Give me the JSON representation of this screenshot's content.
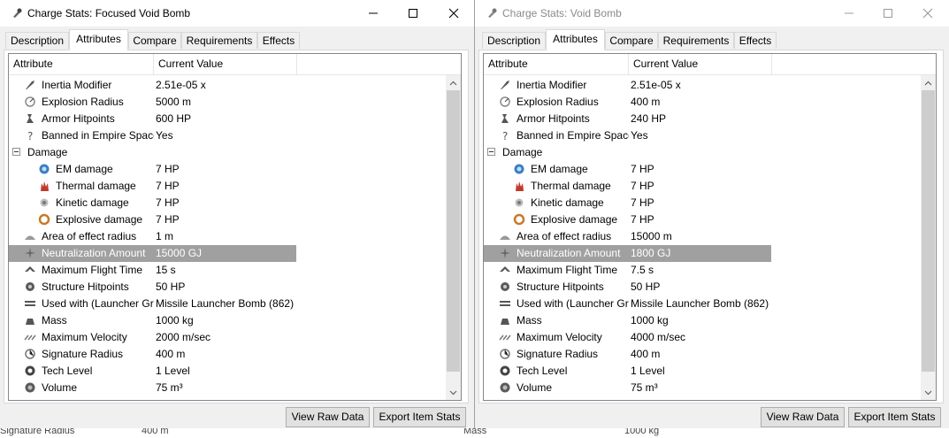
{
  "windows": [
    {
      "title": "Charge Stats: Focused Void Bomb",
      "tabs": [
        "Description",
        "Attributes",
        "Compare",
        "Requirements",
        "Effects"
      ],
      "active_tab": "Attributes",
      "columns": [
        "Attribute",
        "Current Value"
      ],
      "rows": [
        {
          "label": "Inertia Modifier",
          "value": "2.51e-05 x",
          "icon": "rocket-icon"
        },
        {
          "label": "Explosion Radius",
          "value": "5000 m",
          "icon": "explosion-radius-icon"
        },
        {
          "label": "Armor Hitpoints",
          "value": "600 HP",
          "icon": "armor-icon"
        },
        {
          "label": "Banned in Empire Space",
          "value": "Yes",
          "icon": "question-icon"
        },
        {
          "label": "Damage",
          "value": "",
          "icon": "",
          "group": true
        },
        {
          "label": "EM damage",
          "value": "7 HP",
          "icon": "em-damage-icon",
          "child": true
        },
        {
          "label": "Thermal damage",
          "value": "7 HP",
          "icon": "thermal-damage-icon",
          "child": true
        },
        {
          "label": "Kinetic damage",
          "value": "7 HP",
          "icon": "kinetic-damage-icon",
          "child": true
        },
        {
          "label": "Explosive damage",
          "value": "7 HP",
          "icon": "explosive-damage-icon",
          "child": true
        },
        {
          "label": "Area of effect radius",
          "value": "1 m",
          "icon": "area-effect-icon"
        },
        {
          "label": "Neutralization Amount",
          "value": "15000 GJ",
          "icon": "neutralizer-icon",
          "selected": true
        },
        {
          "label": "Maximum Flight Time",
          "value": "15 s",
          "icon": "flight-time-icon"
        },
        {
          "label": "Structure Hitpoints",
          "value": "50 HP",
          "icon": "structure-icon"
        },
        {
          "label": "Used with (Launcher Group)",
          "value": "Missile Launcher Bomb (862)",
          "icon": "launcher-icon"
        },
        {
          "label": "Mass",
          "value": "1000 kg",
          "icon": "mass-icon"
        },
        {
          "label": "Maximum Velocity",
          "value": "2000 m/sec",
          "icon": "velocity-icon"
        },
        {
          "label": "Signature Radius",
          "value": "400 m",
          "icon": "signature-icon"
        },
        {
          "label": "Tech Level",
          "value": "1 Level",
          "icon": "tech-level-icon"
        },
        {
          "label": "Volume",
          "value": "75 m³",
          "icon": "volume-icon"
        }
      ],
      "buttons": [
        "View Raw Data",
        "Export Item Stats"
      ]
    },
    {
      "title": "Charge Stats: Void Bomb",
      "tabs": [
        "Description",
        "Attributes",
        "Compare",
        "Requirements",
        "Effects"
      ],
      "active_tab": "Attributes",
      "columns": [
        "Attribute",
        "Current Value"
      ],
      "rows": [
        {
          "label": "Inertia Modifier",
          "value": "2.51e-05 x",
          "icon": "rocket-icon"
        },
        {
          "label": "Explosion Radius",
          "value": "400 m",
          "icon": "explosion-radius-icon"
        },
        {
          "label": "Armor Hitpoints",
          "value": "240 HP",
          "icon": "armor-icon"
        },
        {
          "label": "Banned in Empire Space",
          "value": "Yes",
          "icon": "question-icon"
        },
        {
          "label": "Damage",
          "value": "",
          "icon": "",
          "group": true
        },
        {
          "label": "EM damage",
          "value": "7 HP",
          "icon": "em-damage-icon",
          "child": true
        },
        {
          "label": "Thermal damage",
          "value": "7 HP",
          "icon": "thermal-damage-icon",
          "child": true
        },
        {
          "label": "Kinetic damage",
          "value": "7 HP",
          "icon": "kinetic-damage-icon",
          "child": true
        },
        {
          "label": "Explosive damage",
          "value": "7 HP",
          "icon": "explosive-damage-icon",
          "child": true
        },
        {
          "label": "Area of effect radius",
          "value": "15000 m",
          "icon": "area-effect-icon"
        },
        {
          "label": "Neutralization Amount",
          "value": "1800 GJ",
          "icon": "neutralizer-icon",
          "selected": true
        },
        {
          "label": "Maximum Flight Time",
          "value": "7.5 s",
          "icon": "flight-time-icon"
        },
        {
          "label": "Structure Hitpoints",
          "value": "50 HP",
          "icon": "structure-icon"
        },
        {
          "label": "Used with (Launcher Group)",
          "value": "Missile Launcher Bomb (862)",
          "icon": "launcher-icon"
        },
        {
          "label": "Mass",
          "value": "1000 kg",
          "icon": "mass-icon"
        },
        {
          "label": "Maximum Velocity",
          "value": "4000 m/sec",
          "icon": "velocity-icon"
        },
        {
          "label": "Signature Radius",
          "value": "400 m",
          "icon": "signature-icon"
        },
        {
          "label": "Tech Level",
          "value": "1 Level",
          "icon": "tech-level-icon"
        },
        {
          "label": "Volume",
          "value": "75 m³",
          "icon": "volume-icon"
        }
      ],
      "buttons": [
        "View Raw Data",
        "Export Item Stats"
      ]
    }
  ],
  "background": {
    "left_text_1": "Signature Radius",
    "left_text_2": "400 m",
    "right_text_1": "Mass",
    "right_text_2": "1000 kg"
  }
}
